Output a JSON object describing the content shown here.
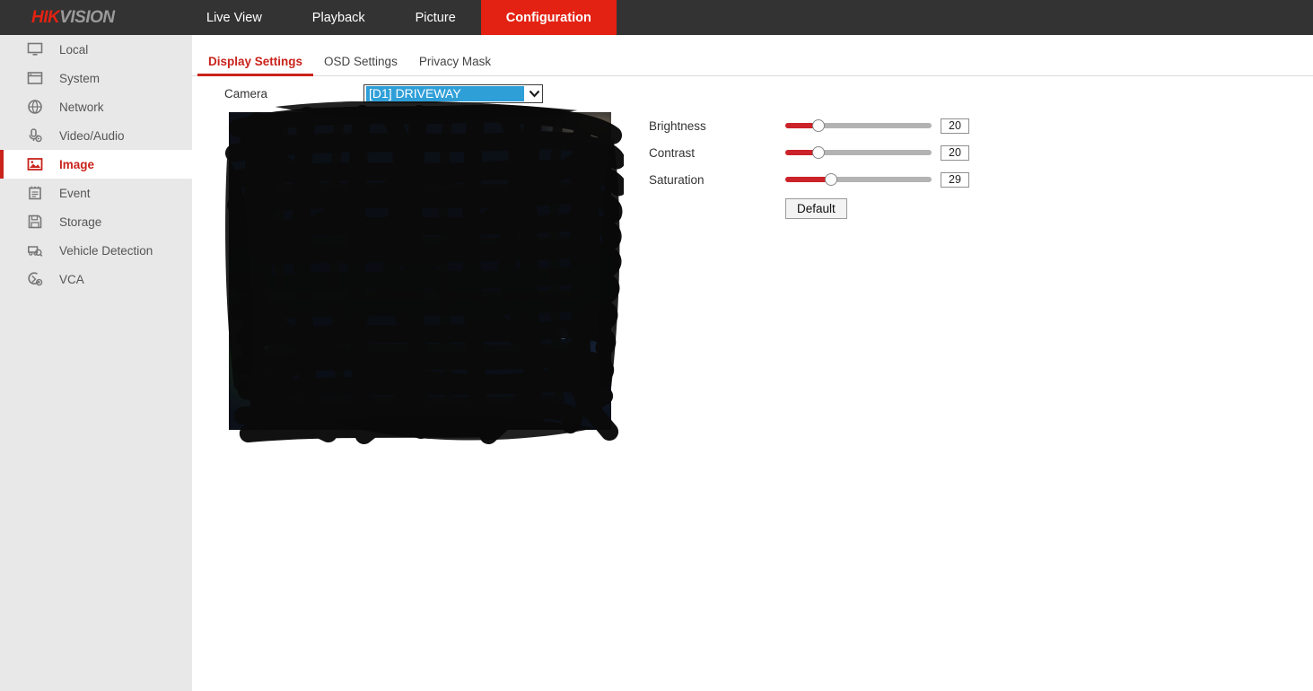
{
  "header": {
    "logo_hik": "HIK",
    "logo_vision": "VISION",
    "nav": [
      {
        "label": "Live View",
        "active": false
      },
      {
        "label": "Playback",
        "active": false
      },
      {
        "label": "Picture",
        "active": false
      },
      {
        "label": "Configuration",
        "active": true
      }
    ]
  },
  "sidebar": {
    "items": [
      {
        "label": "Local",
        "icon": "monitor-icon",
        "active": false
      },
      {
        "label": "System",
        "icon": "window-icon",
        "active": false
      },
      {
        "label": "Network",
        "icon": "globe-icon",
        "active": false
      },
      {
        "label": "Video/Audio",
        "icon": "microphone-icon",
        "active": false
      },
      {
        "label": "Image",
        "icon": "picture-icon",
        "active": true
      },
      {
        "label": "Event",
        "icon": "calendar-icon",
        "active": false
      },
      {
        "label": "Storage",
        "icon": "floppy-disk-icon",
        "active": false
      },
      {
        "label": "Vehicle Detection",
        "icon": "vehicle-search-icon",
        "active": false
      },
      {
        "label": "VCA",
        "icon": "vca-icon",
        "active": false
      }
    ]
  },
  "tabs": [
    {
      "label": "Display Settings",
      "active": true
    },
    {
      "label": "OSD Settings",
      "active": false
    },
    {
      "label": "Privacy Mask",
      "active": false
    }
  ],
  "camera": {
    "label": "Camera",
    "selected": "[D1] DRIVEWAY",
    "arrow_icon": "chevron-down-icon"
  },
  "image_settings": {
    "sliders": [
      {
        "label": "Brightness",
        "value": "20",
        "percent": 23
      },
      {
        "label": "Contrast",
        "value": "20",
        "percent": 23
      },
      {
        "label": "Saturation",
        "value": "29",
        "percent": 31
      }
    ],
    "default_button": "Default"
  },
  "colors": {
    "brand_red": "#e32213",
    "active_red": "#c9231b",
    "slider_red": "#cc2229",
    "topbar_dark": "#333333",
    "sidebar_grey": "#e8e8e8",
    "select_highlight_blue": "#2f9fd8"
  },
  "preview": {
    "description": "live-video-preview-redacted"
  }
}
